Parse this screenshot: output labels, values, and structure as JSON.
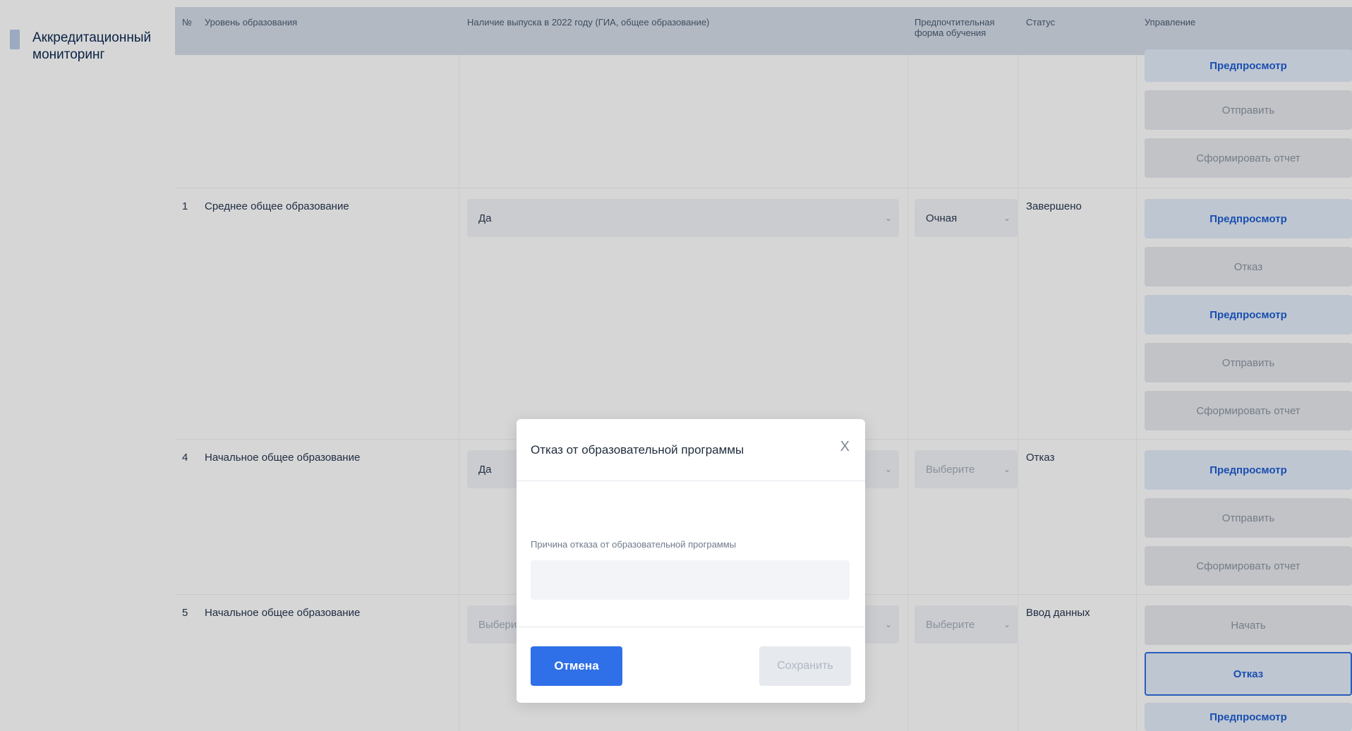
{
  "sidebar": {
    "item_label": "Аккредитационный мониторинг"
  },
  "table": {
    "headers": {
      "num": "№",
      "level": "Уровень образования",
      "presence": "Наличие выпуска в 2022 году (ГИА, общее образование)",
      "form": "Предпочтительная форма обучения",
      "status": "Статус",
      "manage": "Управление"
    },
    "rows": [
      {
        "num": "",
        "level": "",
        "presence": "",
        "form": "",
        "status": ""
      },
      {
        "num": "1",
        "level": "Среднее общее образование",
        "presence": "Да",
        "form": "Очная",
        "status": "Завершено"
      },
      {
        "num": "4",
        "level": "Начальное общее образование",
        "presence": "Да",
        "form": "Выберите",
        "status": "Отказ"
      },
      {
        "num": "5",
        "level": "Начальное общее образование",
        "presence": "Выберите",
        "form": "Выберите",
        "status": "Ввод данных"
      }
    ],
    "actions": {
      "preview": "Предпросмотр",
      "send": "Отправить",
      "generate_report": "Сформировать отчет",
      "decline": "Отказ",
      "refuse": "Отказ",
      "start": "Начать"
    }
  },
  "modal": {
    "title": "Отказ от образовательной программы",
    "close": "X",
    "reason_label": "Причина отказа от образовательной программы",
    "reason_value": "",
    "cancel": "Отмена",
    "save": "Сохранить"
  }
}
